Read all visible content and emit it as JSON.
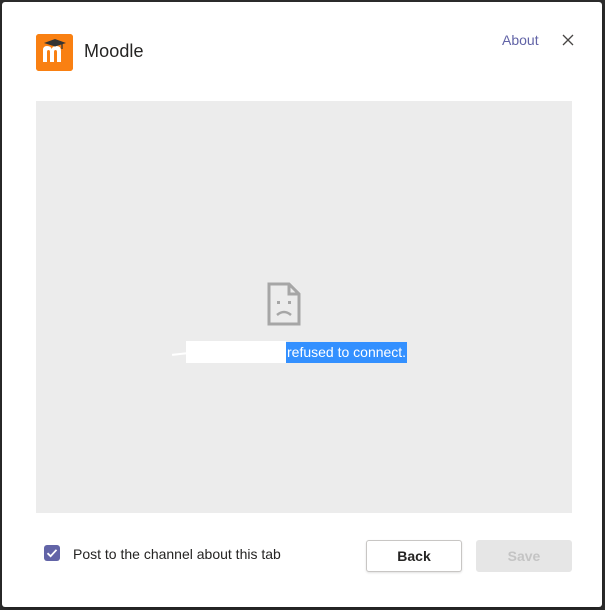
{
  "dialog": {
    "app_name": "Moodle",
    "about_label": "About",
    "icons": {
      "logo": "moodle-logo-icon",
      "close": "close-icon",
      "error": "sad-page-icon",
      "check": "checkmark-icon"
    },
    "colors": {
      "accent": "#6264a7",
      "logo_bg": "#f98012",
      "selection": "#3390ff",
      "frame_bg": "#ececec"
    }
  },
  "frame": {
    "error_message": "refused to connect."
  },
  "footer": {
    "post_checkbox_label": "Post to the channel about this tab",
    "post_checkbox_checked": true,
    "back_label": "Back",
    "save_label": "Save",
    "save_disabled": true
  }
}
